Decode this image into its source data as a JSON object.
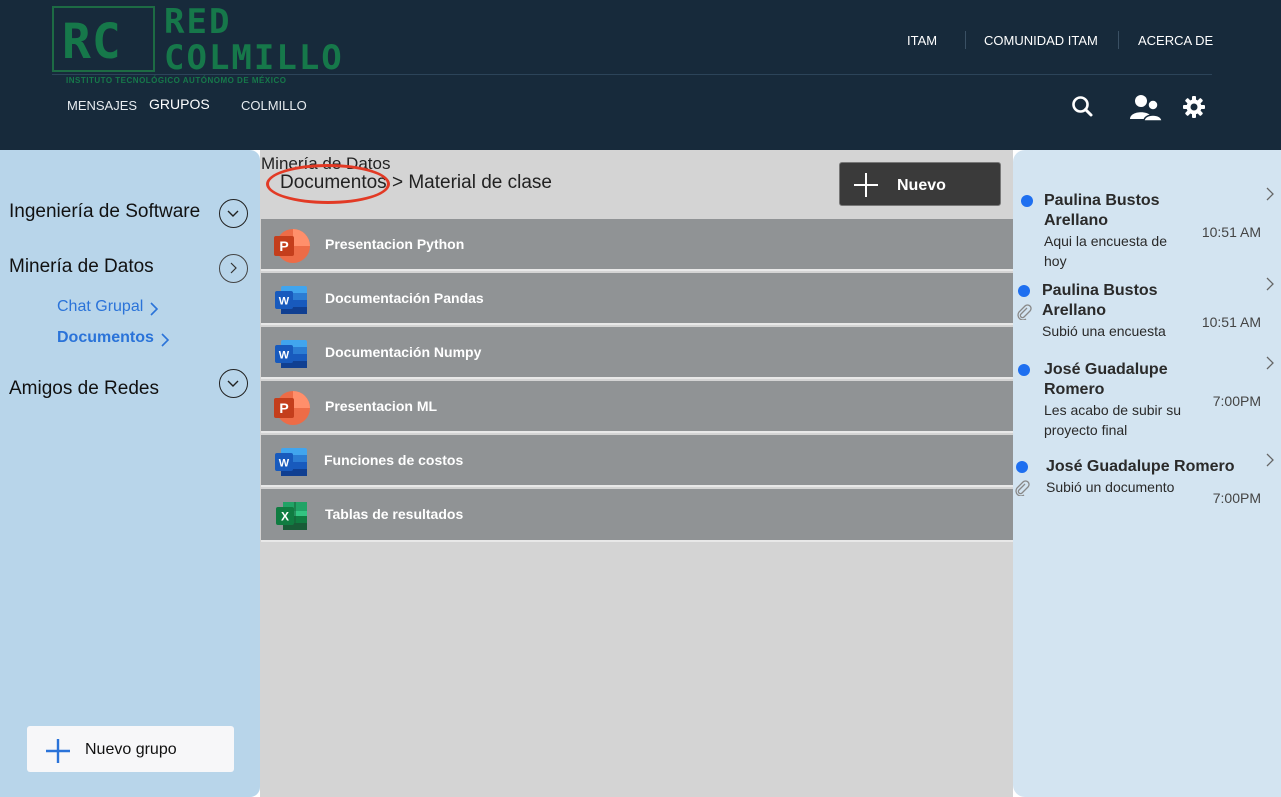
{
  "brand": {
    "initials": "RC",
    "name_line1": "RED",
    "name_line2": "COLMILLO",
    "subtitle": "INSTITUTO TECNOLÓGICO AUTÓNOMO DE MÉXICO"
  },
  "top_nav": [
    "ITAM",
    "COMUNIDAD ITAM",
    "ACERCA DE"
  ],
  "sub_nav": [
    "MENSAJES",
    "GRUPOS",
    "COLMILLO"
  ],
  "header_icons": [
    "search-icon",
    "contacts-icon",
    "gear-icon"
  ],
  "sidebar": {
    "groups": [
      {
        "label": "Ingeniería de Software",
        "state": "collapsed"
      },
      {
        "label": "Minería de Datos",
        "state": "expanded"
      },
      {
        "label": "Amigos de Redes",
        "state": "collapsed"
      }
    ],
    "subitems": [
      {
        "label": "Chat Grupal"
      },
      {
        "label": "Documentos"
      }
    ],
    "new_group_label": "Nuevo grupo"
  },
  "main": {
    "breadcrumb_top": "Minería de Datos",
    "breadcrumb_current": "Documentos",
    "breadcrumb_sep": ">",
    "breadcrumb_folder": "Material de clase",
    "new_button_label": "Nuevo",
    "files": [
      {
        "name": "Presentacion Python",
        "type": "powerpoint"
      },
      {
        "name": "Documentación Pandas",
        "type": "word"
      },
      {
        "name": "Documentación Numpy",
        "type": "word"
      },
      {
        "name": "Presentacion ML",
        "type": "powerpoint"
      },
      {
        "name": "Funciones de costos",
        "type": "word"
      },
      {
        "name": "Tablas de resultados",
        "type": "excel"
      }
    ]
  },
  "messages": [
    {
      "sender": "Paulina Bustos Arellano",
      "text": "Aqui la encuesta de hoy",
      "time": "10:51 AM",
      "attachment": false
    },
    {
      "sender": "Paulina Bustos Arellano",
      "text": "Subió una encuesta",
      "time": "10:51 AM",
      "attachment": true
    },
    {
      "sender": "José Guadalupe Romero",
      "text": "Les acabo de subir su proyecto final",
      "time": "7:00PM",
      "attachment": false
    },
    {
      "sender": "José Guadalupe Romero",
      "text": "Subió un documento",
      "time": "7:00PM",
      "attachment": true
    }
  ],
  "colors": {
    "header_bg": "#172a3b",
    "brand_green": "#16784a",
    "sidebar_bg": "#b8d5ea",
    "link_blue": "#2a73d9",
    "center_bg": "#d4d4d4",
    "file_row_bg": "#909395",
    "panel_bg": "#d3e4f1",
    "unread_dot": "#1e6ff0",
    "highlight_ring": "#e23a25"
  }
}
